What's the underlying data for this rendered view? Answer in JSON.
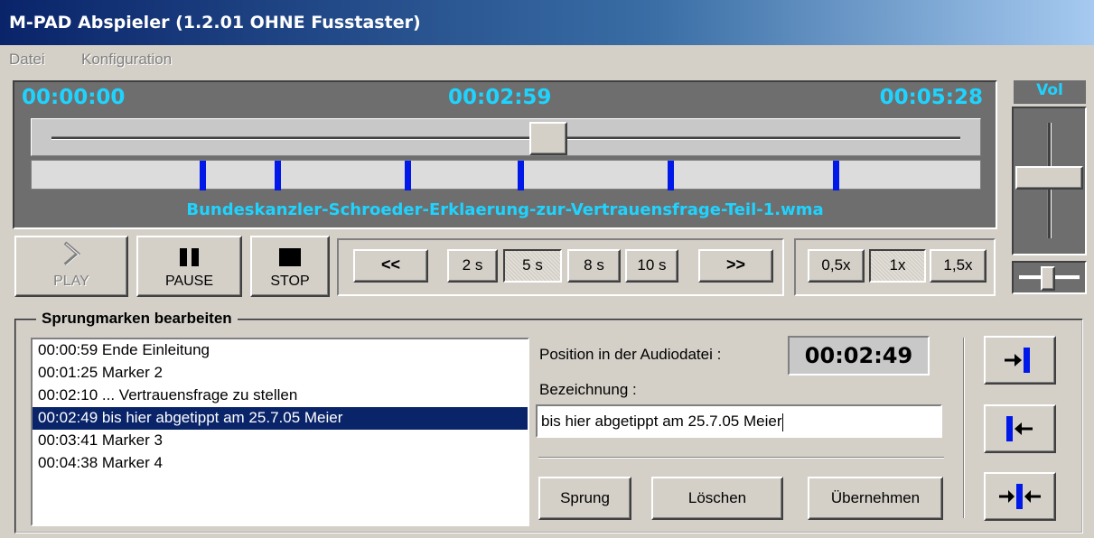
{
  "window": {
    "title": "M-PAD Abspieler (1.2.01  OHNE Fusstaster)"
  },
  "menu": {
    "items": [
      "Datei",
      "Konfiguration"
    ]
  },
  "display": {
    "time_start": "00:00:00",
    "time_current": "00:02:59",
    "time_end": "00:05:28",
    "position_fraction": 0.545,
    "markers_seconds": [
      59,
      85,
      130,
      169,
      221,
      278
    ],
    "duration_seconds": 328,
    "filename": "Bundeskanzler-Schroeder-Erklaerung-zur-Vertrauensfrage-Teil-1.wma",
    "accent_color": "#1fd3ff",
    "marker_color": "#0018e8"
  },
  "transport": {
    "play_label": "PLAY",
    "pause_label": "PAUSE",
    "stop_label": "STOP",
    "play_icon": "chevron-right-icon",
    "pause_icon": "pause-icon",
    "stop_icon": "stop-icon",
    "play_enabled": false
  },
  "skip": {
    "back_label": "<<",
    "forward_label": ">>",
    "intervals": [
      "2 s",
      "5 s",
      "8 s",
      "10 s"
    ],
    "selected": "5 s"
  },
  "speed": {
    "options": [
      "0,5x",
      "1x",
      "1,5x"
    ],
    "selected": "1x"
  },
  "volume": {
    "label": "Vol",
    "level": 0.6,
    "balance": 0.5
  },
  "markers": {
    "legend": "Sprungmarken bearbeiten",
    "items": [
      "00:00:59  Ende Einleitung",
      "00:01:25  Marker 2",
      "00:02:10  ... Vertrauensfrage zu stellen",
      "00:02:49  bis hier abgetippt am 25.7.05 Meier",
      "00:03:41  Marker 3",
      "00:04:38  Marker 4"
    ],
    "selected_index": 3,
    "position_label": "Position in der Audiodatei :",
    "position_value": "00:02:49",
    "name_label": "Bezeichnung :",
    "name_value": "bis hier abgetippt am 25.7.05 Meier",
    "jump_label": "Sprung",
    "delete_label": "Löschen",
    "apply_label": "Übernehmen",
    "side_icons": [
      "set-marker-right-icon",
      "set-marker-left-icon",
      "marker-center-icon"
    ]
  }
}
